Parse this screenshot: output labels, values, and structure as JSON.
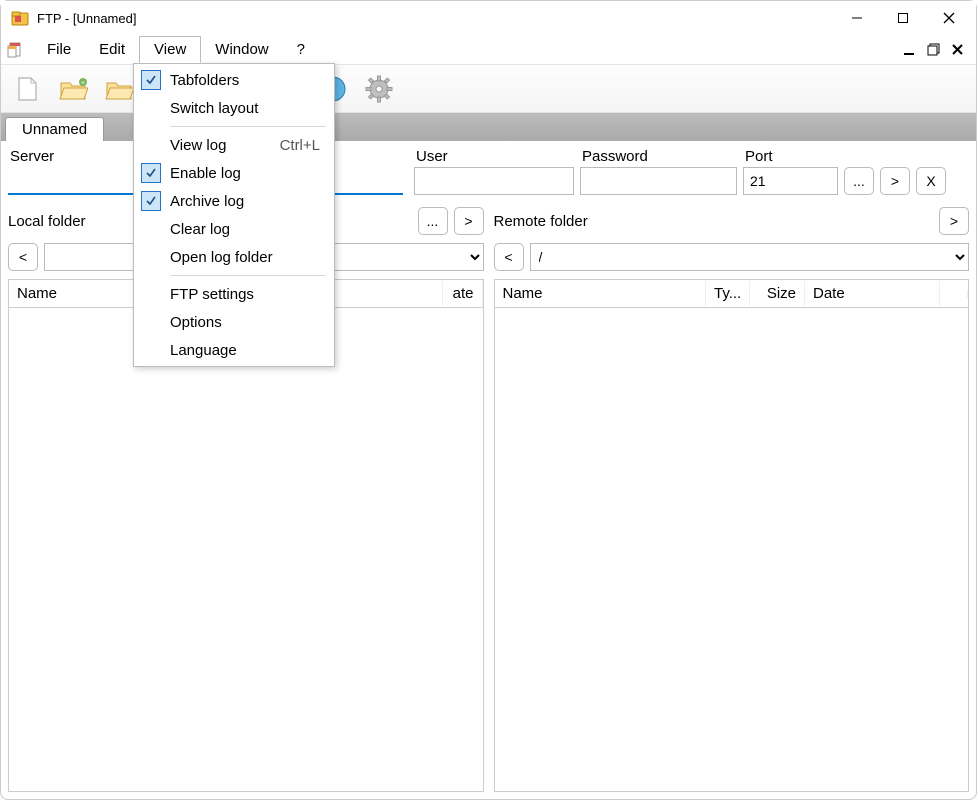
{
  "title": "FTP - [Unnamed]",
  "menus": {
    "file": "File",
    "edit": "Edit",
    "view": "View",
    "window": "Window",
    "help": "?"
  },
  "view_menu": {
    "tabfolders": "Tabfolders",
    "switch_layout": "Switch layout",
    "view_log": "View log",
    "view_log_shortcut": "Ctrl+L",
    "enable_log": "Enable log",
    "archive_log": "Archive log",
    "clear_log": "Clear log",
    "open_log_folder": "Open log folder",
    "ftp_settings": "FTP settings",
    "options": "Options",
    "language": "Language"
  },
  "tab": {
    "label": "Unnamed"
  },
  "conn": {
    "server_label": "Server",
    "server_value": "",
    "user_label": "User",
    "user_value": "",
    "password_label": "Password",
    "password_value": "",
    "port_label": "Port",
    "port_value": "21",
    "browse": "...",
    "go": ">",
    "close": "X"
  },
  "folders": {
    "local_label": "Local folder",
    "local_value": "",
    "remote_label": "Remote folder",
    "remote_value": "/",
    "browse": "...",
    "open": ">",
    "back": "<"
  },
  "listcols": {
    "name": "Name",
    "type": "Ty...",
    "size": "Size",
    "date": "Date",
    "date2": "ate"
  }
}
